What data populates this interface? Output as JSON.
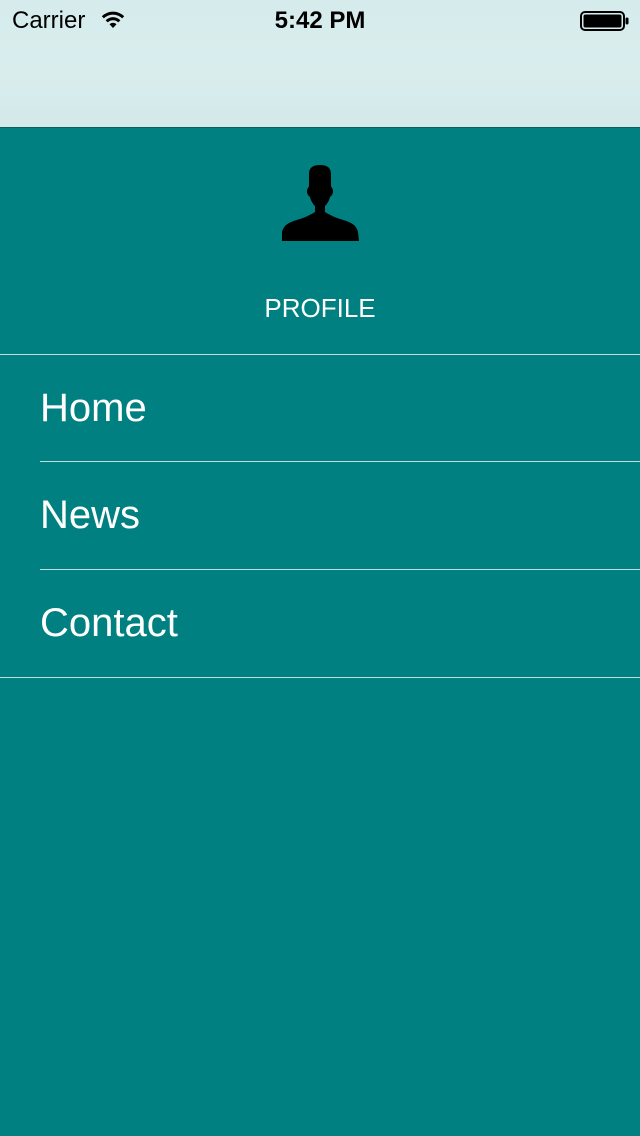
{
  "status_bar": {
    "carrier": "Carrier",
    "time": "5:42 PM",
    "wifi_icon": "wifi-icon",
    "battery_icon": "battery-icon"
  },
  "profile": {
    "label": "PROFILE",
    "avatar_icon": "person-silhouette-icon"
  },
  "menu": {
    "items": [
      {
        "label": "Home"
      },
      {
        "label": "News"
      },
      {
        "label": "Contact"
      }
    ]
  },
  "colors": {
    "background": "#008080",
    "top_area": "#d6ecec",
    "text": "#ffffff",
    "divider": "#bfe0e0"
  }
}
